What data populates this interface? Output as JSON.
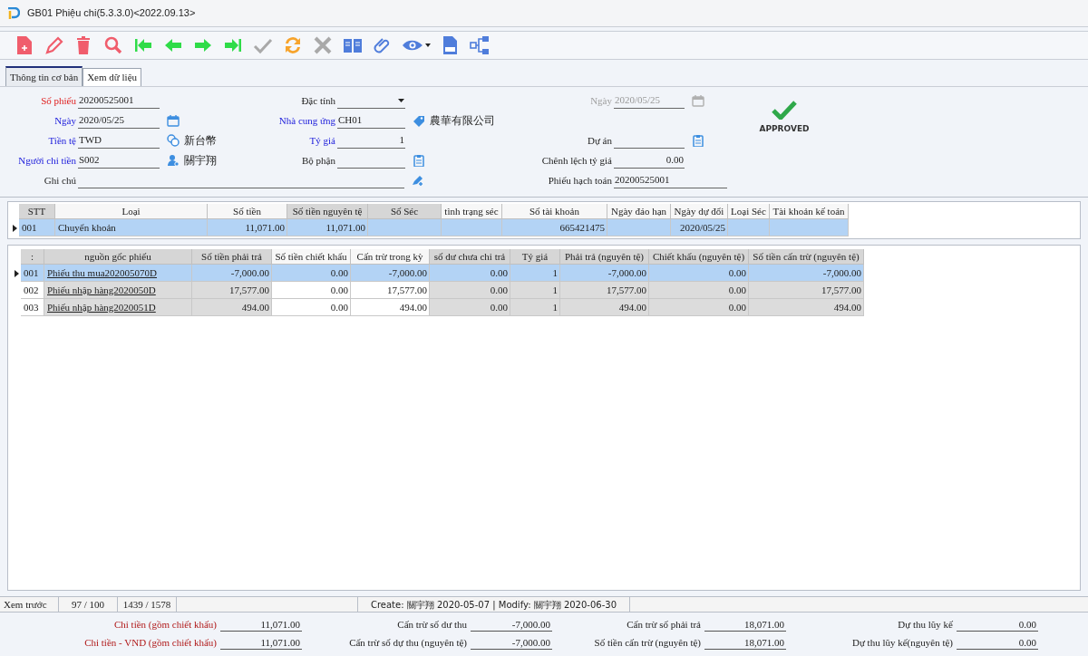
{
  "window": {
    "title": "GB01 Phiệu chi(5.3.3.0)<2022.09.13>"
  },
  "toolbar": [
    {
      "kind": "new",
      "disabled": false
    },
    {
      "kind": "edit",
      "disabled": false
    },
    {
      "kind": "delete",
      "disabled": false
    },
    {
      "kind": "search",
      "disabled": false
    },
    {
      "kind": "first",
      "disabled": false
    },
    {
      "kind": "prev",
      "disabled": false
    },
    {
      "kind": "next",
      "disabled": false
    },
    {
      "kind": "last",
      "disabled": false
    },
    {
      "kind": "confirm",
      "disabled": true
    },
    {
      "kind": "refresh",
      "disabled": false
    },
    {
      "kind": "cancel",
      "disabled": true
    },
    {
      "kind": "book",
      "disabled": false
    },
    {
      "kind": "attach",
      "disabled": false
    },
    {
      "kind": "view",
      "disabled": false
    },
    {
      "kind": "export",
      "disabled": false
    },
    {
      "kind": "tree",
      "disabled": false
    }
  ],
  "tabs": [
    {
      "label": "Thông tin cơ bản",
      "selected": true
    },
    {
      "label": "Xem dữ liệu",
      "selected": false
    }
  ],
  "form": {
    "rows": [
      {
        "left": {
          "label": "Số phiếu",
          "required": true,
          "value": "20200525001"
        },
        "middle": {
          "label": "Đặc tính",
          "kind": "select"
        },
        "right": {
          "label": "Ngày",
          "disabled": true,
          "value": "2020/05/25",
          "kind": "date"
        }
      },
      {
        "left": {
          "label": "Ngày",
          "linked": true,
          "value": "2020/05/25",
          "kind": "date"
        },
        "middle": {
          "label": "Nhà cung ứng",
          "linked": true,
          "value": "CH01",
          "kind": "tag",
          "extra": "農華有限公司"
        }
      },
      {
        "left": {
          "label": "Tiền tệ",
          "linked": true,
          "value": "TWD",
          "kind": "currency",
          "extra": "新台幣"
        },
        "middle": {
          "label": "Tỷ giá",
          "linked": true,
          "value": "1",
          "kind": "number"
        },
        "right": {
          "label": "Dự án",
          "kind": "clipboard"
        }
      },
      {
        "left": {
          "label": "Người chi tiền",
          "linked": true,
          "value": "S002",
          "kind": "person",
          "extra": "關宇翔"
        },
        "middle": {
          "label": "Bộ phận",
          "kind": "clipboard"
        },
        "right": {
          "label": "Chênh lệch tỷ giá",
          "value": "0.00",
          "kind": "number"
        }
      },
      {
        "left": {
          "label": "Ghi chú",
          "kind": "note"
        },
        "right": {
          "label": "Phiếu hạch toán",
          "value": "20200525001",
          "kind": "long"
        }
      }
    ],
    "status": {
      "approved": true,
      "label": "APPROVED"
    }
  },
  "payment_grid": {
    "columns": [
      {
        "label": "STT",
        "editable": false
      },
      {
        "label": "Loại",
        "editable": true
      },
      {
        "label": "Số tiền",
        "editable": true
      },
      {
        "label": "Số tiền nguyên tệ",
        "editable": false
      },
      {
        "label": "Số Séc",
        "editable": false
      },
      {
        "label": "tình trạng séc",
        "editable": true
      },
      {
        "label": "Số tài khoản",
        "editable": true
      },
      {
        "label": "Ngày đáo hạn",
        "editable": true
      },
      {
        "label": "Ngày dự đổi",
        "editable": true
      },
      {
        "label": "Loại Séc",
        "editable": true
      },
      {
        "label": "Tài khoản kế toán",
        "editable": true
      }
    ],
    "rows": [
      {
        "selected": true,
        "cells": [
          "001",
          "Chuyển khoản",
          "11,071.00",
          "11,071.00",
          null,
          null,
          "665421475",
          null,
          "2020/05/25",
          null,
          null
        ]
      }
    ]
  },
  "source_grid": {
    "columns": [
      {
        "label": ":",
        "editable": false
      },
      {
        "label": "nguồn gốc phiếu",
        "editable": false
      },
      {
        "label": "Số tiền phải trả",
        "editable": false
      },
      {
        "label": "Số tiền chiết khấu",
        "editable": true
      },
      {
        "label": "Cấn trừ trong kỳ",
        "editable": true
      },
      {
        "label": "số dư chưa chi trả",
        "editable": false
      },
      {
        "label": "Tỷ giá",
        "editable": false
      },
      {
        "label": "Phải trả (nguyên tệ)",
        "editable": false
      },
      {
        "label": "Chiết khấu (nguyên tệ)",
        "editable": false
      },
      {
        "label": "Số tiền cấn trừ (nguyên tệ)",
        "editable": false
      }
    ],
    "rows": [
      {
        "selected": true,
        "cells": [
          "001",
          "Phiếu thu mua202005070D",
          "-7,000.00",
          "0.00",
          "-7,000.00",
          "0.00",
          "1",
          "-7,000.00",
          "0.00",
          "-7,000.00"
        ]
      },
      {
        "selected": false,
        "cells": [
          "002",
          "Phiếu nhập hàng2020050D",
          "17,577.00",
          "0.00",
          "17,577.00",
          "0.00",
          "1",
          "17,577.00",
          "0.00",
          "17,577.00"
        ]
      },
      {
        "selected": false,
        "cells": [
          "003",
          "Phiếu nhập hàng2020051D",
          "494.00",
          "0.00",
          "494.00",
          "0.00",
          "1",
          "494.00",
          "0.00",
          "494.00"
        ]
      }
    ]
  },
  "status_bar": [
    "Xem trước",
    "97 / 100",
    "1439 / 1578",
    "Create: 關宇翔 2020-05-07 | Modify: 關宇翔 2020-06-30"
  ],
  "totals": [
    [
      {
        "label": "Chi tiền (gồm chiết khấu)",
        "highlight": true,
        "value": "11,071.00"
      },
      {
        "label": "Cấn trừ số dư thu",
        "highlight": false,
        "value": "-7,000.00"
      },
      {
        "label": "Cấn trừ số phải trả",
        "highlight": false,
        "value": "18,071.00"
      },
      {
        "label": "Dự thu lũy kế",
        "highlight": false,
        "value": "0.00"
      }
    ],
    [
      {
        "label": "Chi tiền - VND (gồm chiết khấu)",
        "highlight": true,
        "value": "11,071.00"
      },
      {
        "label": "Cấn trừ số dự thu (nguyên tệ)",
        "highlight": false,
        "value": "-7,000.00"
      },
      {
        "label": "Số tiền cấn trừ (nguyên tệ)",
        "highlight": false,
        "value": "18,071.00"
      },
      {
        "label": "Dự thu lũy kế(nguyên tệ)",
        "highlight": false,
        "value": "0.00"
      }
    ]
  ]
}
